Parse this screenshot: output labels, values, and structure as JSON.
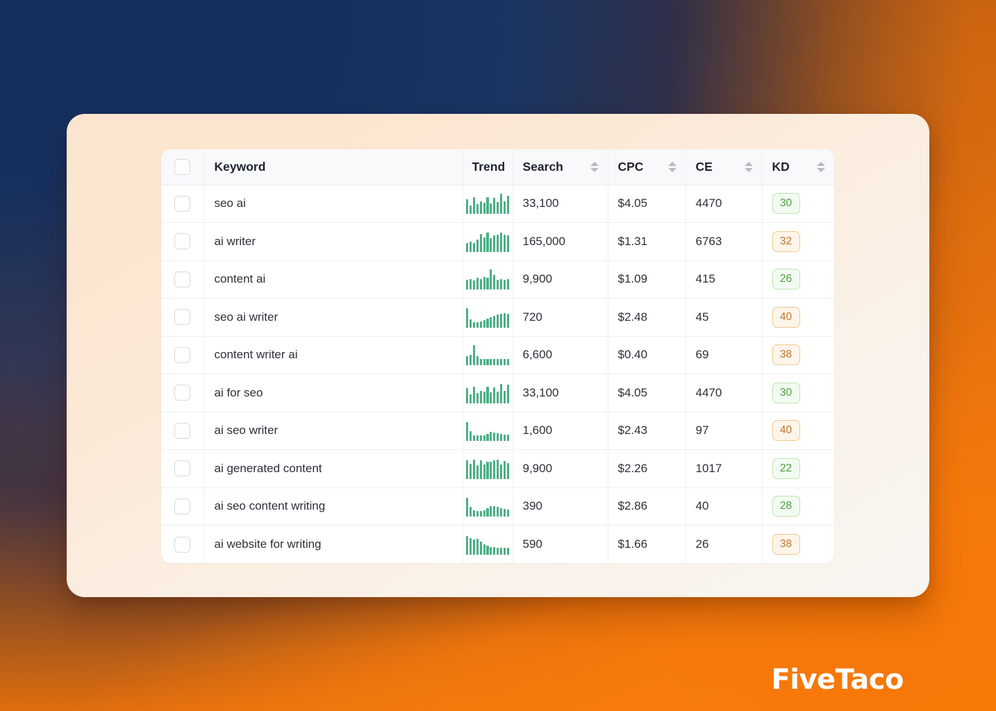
{
  "brand": {
    "logo_text": "FiveTaco"
  },
  "table": {
    "columns": [
      {
        "key": "check",
        "label": "",
        "sortable": false
      },
      {
        "key": "keyword",
        "label": "Keyword",
        "sortable": false
      },
      {
        "key": "trend",
        "label": "Trend",
        "sortable": false
      },
      {
        "key": "search",
        "label": "Search",
        "sortable": true
      },
      {
        "key": "cpc",
        "label": "CPC",
        "sortable": true
      },
      {
        "key": "ce",
        "label": "CE",
        "sortable": true
      },
      {
        "key": "kd",
        "label": "KD",
        "sortable": true
      }
    ],
    "rows": [
      {
        "keyword": "seo ai",
        "search": "33,100",
        "cpc": "$4.05",
        "ce": "4470",
        "kd": "30",
        "kd_level": "easy",
        "trend": [
          72,
          40,
          82,
          48,
          60,
          55,
          80,
          52,
          78,
          58,
          96,
          60,
          88
        ]
      },
      {
        "keyword": "ai writer",
        "search": "165,000",
        "cpc": "$1.31",
        "ce": "6763",
        "kd": "32",
        "kd_level": "medium",
        "trend": [
          44,
          50,
          44,
          58,
          86,
          70,
          92,
          66,
          80,
          82,
          92,
          84,
          78
        ]
      },
      {
        "keyword": "content ai",
        "search": "9,900",
        "cpc": "$1.09",
        "ce": "415",
        "kd": "26",
        "kd_level": "easy",
        "trend": [
          48,
          52,
          44,
          56,
          50,
          62,
          58,
          96,
          72,
          46,
          52,
          48,
          52
        ]
      },
      {
        "keyword": "seo ai writer",
        "search": "720",
        "cpc": "$2.48",
        "ce": "45",
        "kd": "40",
        "kd_level": "medium",
        "trend": [
          92,
          40,
          26,
          24,
          30,
          36,
          42,
          50,
          56,
          62,
          66,
          70,
          66
        ]
      },
      {
        "keyword": "content writer ai",
        "search": "6,600",
        "cpc": "$0.40",
        "ce": "69",
        "kd": "38",
        "kd_level": "medium",
        "trend": [
          44,
          52,
          96,
          44,
          32,
          30,
          30,
          30,
          30,
          32,
          32,
          32,
          30
        ]
      },
      {
        "keyword": "ai for seo",
        "search": "33,100",
        "cpc": "$4.05",
        "ce": "4470",
        "kd": "30",
        "kd_level": "easy",
        "trend": [
          74,
          44,
          80,
          50,
          58,
          56,
          78,
          54,
          76,
          56,
          94,
          58,
          88
        ]
      },
      {
        "keyword": "ai seo writer",
        "search": "1,600",
        "cpc": "$2.43",
        "ce": "97",
        "kd": "40",
        "kd_level": "medium",
        "trend": [
          92,
          46,
          26,
          24,
          24,
          26,
          34,
          44,
          40,
          36,
          34,
          32,
          30
        ]
      },
      {
        "keyword": "ai generated content",
        "search": "9,900",
        "cpc": "$2.26",
        "ce": "1017",
        "kd": "22",
        "kd_level": "easy",
        "trend": [
          88,
          74,
          92,
          66,
          90,
          68,
          84,
          82,
          88,
          92,
          70,
          86,
          76
        ]
      },
      {
        "keyword": "ai seo content writing",
        "search": "390",
        "cpc": "$2.86",
        "ce": "40",
        "kd": "28",
        "kd_level": "easy",
        "trend": [
          92,
          46,
          30,
          26,
          28,
          30,
          42,
          52,
          50,
          46,
          40,
          36,
          34
        ]
      },
      {
        "keyword": "ai website for writing",
        "search": "590",
        "cpc": "$1.66",
        "ce": "26",
        "kd": "38",
        "kd_level": "medium",
        "trend": [
          90,
          80,
          72,
          78,
          64,
          50,
          42,
          38,
          36,
          34,
          34,
          32,
          32
        ]
      }
    ]
  },
  "colors": {
    "sparkline": "#4CAF85",
    "kd_easy_text": "#4C9E3F",
    "kd_easy_bg": "#F2FBF1",
    "kd_easy_border": "#BDE5B1",
    "kd_medium_text": "#C2742A",
    "kd_medium_bg": "#FEF5EA",
    "kd_medium_border": "#F3C88E",
    "card_bg": "#FBE5CE",
    "background_orange": "#F3770B",
    "background_navy": "#16305E"
  }
}
